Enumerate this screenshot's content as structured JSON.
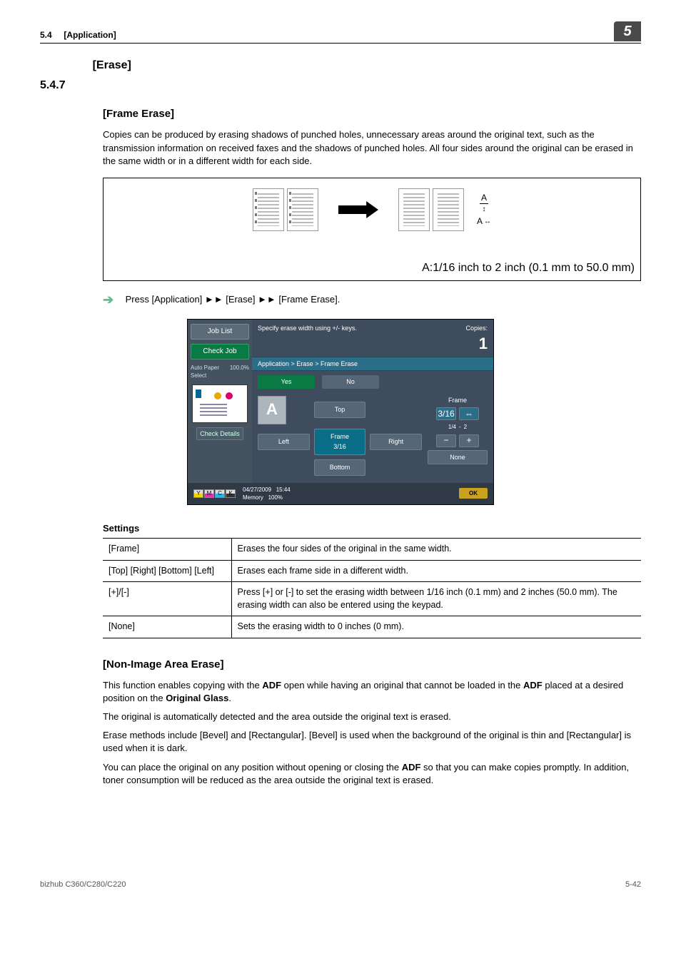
{
  "header": {
    "section_ref": "5.4",
    "section_label": "[Application]",
    "chapter_badge": "5"
  },
  "section": {
    "number": "5.4.7",
    "title": "[Erase]"
  },
  "frame_erase": {
    "heading": "[Frame Erase]",
    "intro": "Copies can be produced by erasing shadows of punched holes, unnecessary areas around the original text, such as the transmission information on received faxes and the shadows of punched holes. All four sides around the original can be erased in the same width or in a different width for each side.",
    "diagram": {
      "marker_top": "A",
      "marker_side": "A",
      "caption": "A:1/16 inch to 2 inch (0.1 mm to 50.0 mm)"
    },
    "nav_line": {
      "prefix": "Press [Application] ",
      "sep": "►►",
      "step2": " [Erase] ",
      "step3": " [Frame Erase]."
    }
  },
  "ui": {
    "left": {
      "job_list": "Job List",
      "check_job": "Check Job",
      "auto_paper": "Auto Paper Select",
      "percent": "100.0%",
      "check_details": "Check Details"
    },
    "hint": "Specify erase width using +/- keys.",
    "copies_label": "Copies:",
    "copies_value": "1",
    "breadcrumb": "Application > Erase > Frame Erase",
    "yes": "Yes",
    "no": "No",
    "a_box": "A",
    "btn_top": "Top",
    "btn_left": "Left",
    "btn_frame": "Frame",
    "btn_right": "Right",
    "btn_bottom": "Bottom",
    "frac": "3/16",
    "right_panel": {
      "label": "Frame",
      "val_left": "3/16",
      "val_right": "⇔",
      "val_bot_l": "1/4",
      "spacer": "-",
      "val_bot_r": "2",
      "minus": "−",
      "plus": "+",
      "none": "None"
    },
    "footer": {
      "toners": [
        "Y",
        "M",
        "C",
        "K"
      ],
      "date": "04/27/2009",
      "time": "15:44",
      "mem_label": "Memory",
      "mem_val": "100%",
      "ok": "OK"
    }
  },
  "settings": {
    "title": "Settings",
    "rows": [
      {
        "k": "[Frame]",
        "v": "Erases the four sides of the original in the same width."
      },
      {
        "k": "[Top] [Right] [Bottom] [Left]",
        "v": "Erases each frame side in a different width."
      },
      {
        "k": "[+]/[-]",
        "v": "Press [+] or [-] to set the erasing width between 1/16 inch (0.1 mm) and 2 inches (50.0 mm). The erasing width can also be entered using the keypad."
      },
      {
        "k": "[None]",
        "v": "Sets the erasing width to 0 inches (0 mm)."
      }
    ]
  },
  "non_image": {
    "heading": "[Non-Image Area Erase]",
    "p1_a": "This function enables copying with the ",
    "p1_b": "ADF",
    "p1_c": " open while having an original that cannot be loaded in the ",
    "p1_d": "ADF",
    "p1_e": " placed at a desired position on the ",
    "p1_f": "Original Glass",
    "p1_g": ".",
    "p2": "The original is automatically detected and the area outside the original text is erased.",
    "p3": "Erase methods include [Bevel] and [Rectangular]. [Bevel] is used when the background of the original is thin and [Rectangular] is used when it is dark.",
    "p4_a": "You can place the original on any position without opening or closing the ",
    "p4_b": "ADF",
    "p4_c": " so that you can make copies promptly. In addition, toner consumption will be reduced as the area outside the original text is erased."
  },
  "footer": {
    "model": "bizhub C360/C280/C220",
    "page": "5-42"
  }
}
